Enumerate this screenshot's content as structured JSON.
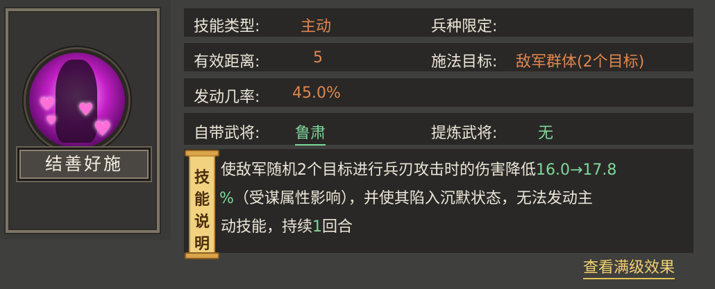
{
  "skill": {
    "name": "结善好施",
    "icon": "heart-charm-skill-icon"
  },
  "info": {
    "skill_type_label": "技能类型:",
    "skill_type_value": "主动",
    "troop_limit_label": "兵种限定:",
    "troop_limit_value": "",
    "range_label": "有效距离:",
    "range_value": "5",
    "target_label": "施法目标:",
    "target_value": "敌军群体(2个目标)",
    "chance_label": "发动几率:",
    "chance_value": "45.0%",
    "own_general_label": "自带武将:",
    "own_general_value": "鲁肃",
    "refine_general_label": "提炼武将:",
    "refine_general_value": "无"
  },
  "description": {
    "scroll_chars": [
      "技",
      "能",
      "说",
      "明"
    ],
    "text_1": "使敌军随机2个目标进行兵刃攻击时的伤害降低",
    "highlight_1": "16.0→17.8",
    "highlight_1b": "%",
    "text_2": "（受谋属性影响），并使其陷入沉默状态，无法发动主",
    "text_3": "动技能，持续",
    "highlight_2": "1",
    "text_4": "回合"
  },
  "actions": {
    "view_max_label": "查看满级效果"
  },
  "colors": {
    "orange": "#e0864e",
    "green": "#7ed89a",
    "gold": "#f0d070"
  }
}
